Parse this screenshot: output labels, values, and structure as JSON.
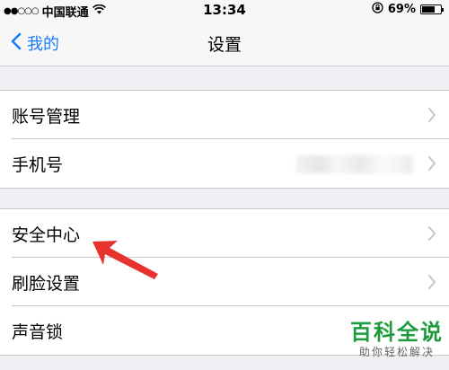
{
  "status_bar": {
    "signal_dots": "●●○○○",
    "carrier": "中国联通",
    "wifi_icon": "wifi-icon",
    "time": "13:34",
    "battery_percent": "69%",
    "battery_level": 0.69
  },
  "nav": {
    "back_label": "我的",
    "title": "设置"
  },
  "group1": {
    "items": [
      {
        "label": "账号管理"
      },
      {
        "label": "手机号"
      }
    ]
  },
  "group2": {
    "items": [
      {
        "label": "安全中心"
      },
      {
        "label": "刷脸设置"
      },
      {
        "label": "声音锁"
      }
    ]
  },
  "watermark": {
    "title": "百科全说",
    "subtitle": "助你轻松解决"
  },
  "colors": {
    "accent": "#157efb",
    "annotation_arrow": "#e8322d",
    "watermark_green": "#1e9c3c"
  }
}
